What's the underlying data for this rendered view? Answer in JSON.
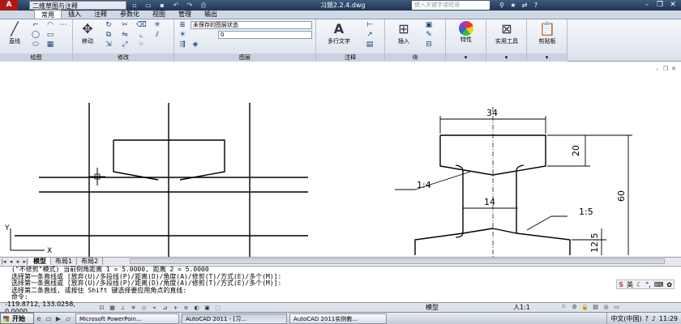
{
  "titlebar": {
    "workspace": "二维草图与注释",
    "document_title": "习题2.2.4.dwg",
    "search_placeholder": "键入关键字或短语"
  },
  "ribbon_tabs": [
    "常用",
    "插入",
    "注释",
    "参数化",
    "视图",
    "管理",
    "输出"
  ],
  "ribbon": {
    "draw": {
      "line_label": "直线",
      "title": "绘图"
    },
    "modify": {
      "move_label": "移动",
      "title": "修改"
    },
    "layers": {
      "state_value": "未保存的图层状态",
      "layer_value": "0",
      "title": "图层"
    },
    "annotation": {
      "mtext_label": "多行文字",
      "title": "注释"
    },
    "block": {
      "insert_label": "插入",
      "title": "块"
    },
    "properties": {
      "label": "特性"
    },
    "utilities": {
      "label": "实用工具"
    },
    "clipboard": {
      "label": "剪贴板"
    }
  },
  "drawing": {
    "dims": {
      "top_width": "34",
      "flange_height": "20",
      "web_width": "14",
      "bottom_height": "12.5",
      "total_height": "60",
      "slope_top": "1:4",
      "slope_bottom": "1:5"
    },
    "ucs_x": "X",
    "ucs_y": "Y"
  },
  "layout_tabs": [
    "模型",
    "布局1",
    "布局2"
  ],
  "command_lines": [
    "(\"不修剪\"模式) 当前倒角距离 1 = 5.0000, 距离 2 = 5.0000",
    "选择第一条直线或 [放弃(U)/多段线(P)/距离(D)/角度(A)/修剪(T)/方式(E)/多个(M)]:",
    "选择第一条直线或 [放弃(U)/多段线(P)/距离(D)/角度(A)/修剪(T)/方式(E)/多个(M)]:",
    "选择第二条直线, 或按住 Shift 键选择要应用角点的直线:",
    "命令:"
  ],
  "ime_label": "英",
  "status": {
    "coords": "-119.8712, 133.0258, 0.0000",
    "model": "模型",
    "scale": "人1:1"
  },
  "taskbar": {
    "start_label": "开始",
    "items": [
      "Microsoft PowerPoin...",
      "AutoCAD 2011 - [习...",
      "AutoCAD 2011实例教..."
    ],
    "lang": "中文(中国)",
    "clock": "11:29"
  },
  "colors": {
    "title_bar": "#2a4366",
    "accent_red": "#b01818"
  }
}
